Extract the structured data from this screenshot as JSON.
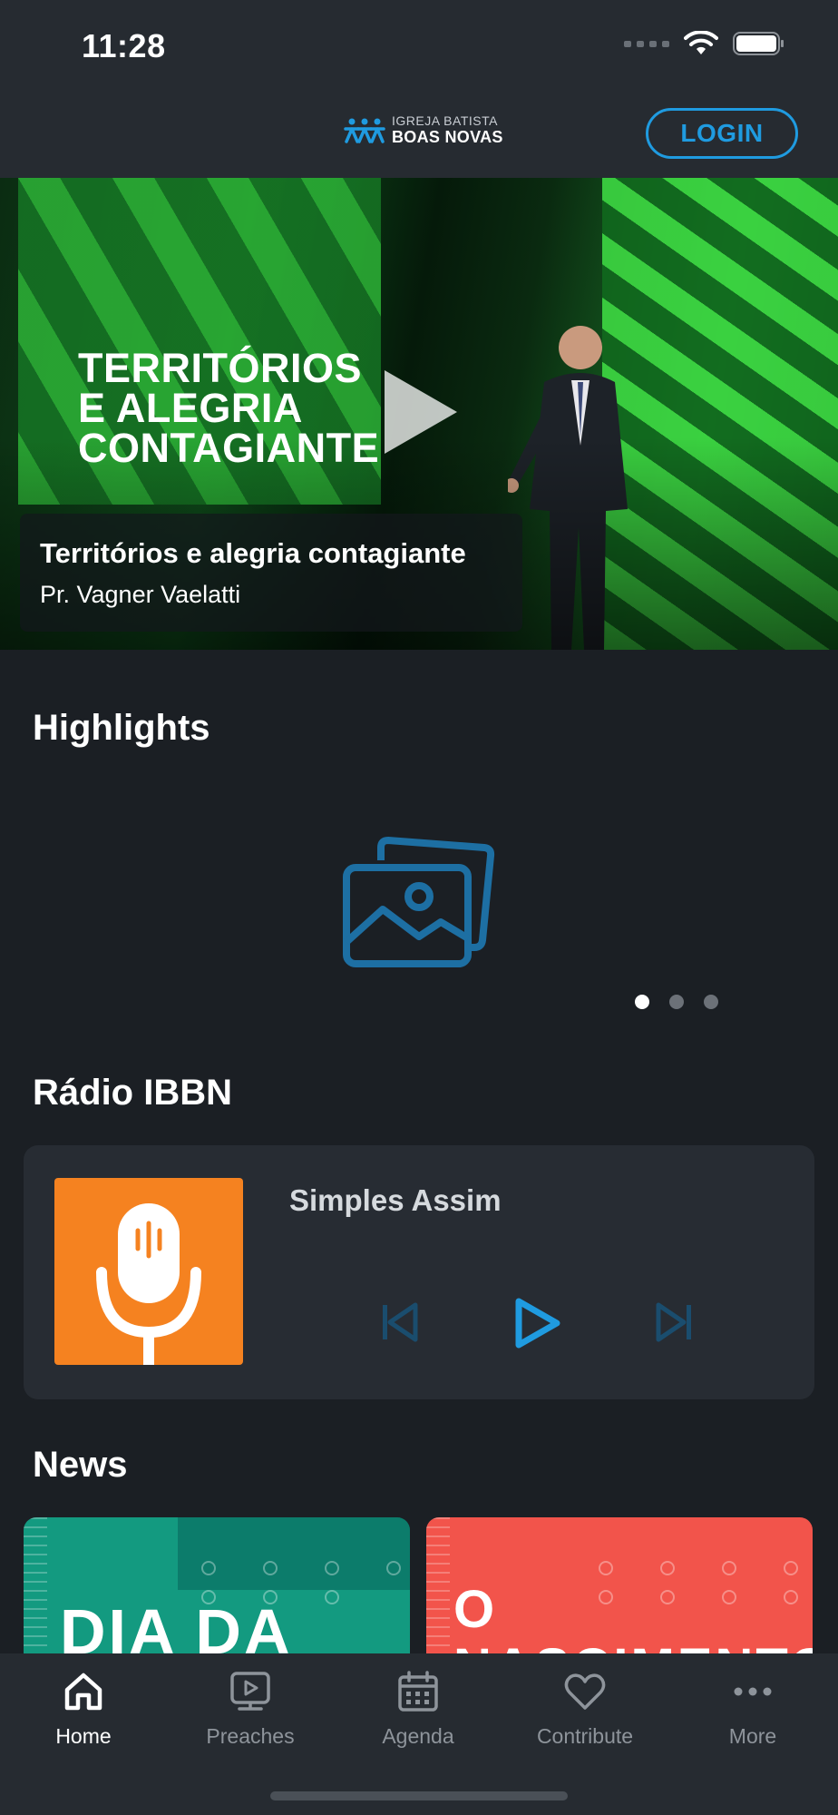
{
  "status_bar": {
    "time": "11:28"
  },
  "header": {
    "logo_line1": "IGREJA BATISTA",
    "logo_line2": "BOAS NOVAS",
    "login_label": "LOGIN",
    "accent_color": "#1f9be0"
  },
  "hero": {
    "art_title_lines": [
      "TERRITÓRIOS",
      "E ALEGRIA",
      "CONTAGIANTE"
    ],
    "caption_title": "Territórios e alegria contagiante",
    "caption_subtitle": "Pr. Vagner Vaelatti"
  },
  "highlights": {
    "title": "Highlights",
    "placeholder_icon": "image-placeholder-icon",
    "pages": 3,
    "active_page": 1
  },
  "radio": {
    "title": "Rádio IBBN",
    "track_title": "Simples Assim",
    "art_icon": "microphone-icon",
    "art_color": "#f58220"
  },
  "news": {
    "title": "News",
    "items": [
      {
        "text": "DIA DA",
        "color": "#139a80"
      },
      {
        "text": "O NASCIMENTO",
        "color": "#f2544b"
      }
    ]
  },
  "tabs": [
    {
      "label": "Home",
      "icon": "home-icon",
      "active": true
    },
    {
      "label": "Preaches",
      "icon": "video-icon",
      "active": false
    },
    {
      "label": "Agenda",
      "icon": "calendar-icon",
      "active": false
    },
    {
      "label": "Contribute",
      "icon": "heart-icon",
      "active": false
    },
    {
      "label": "More",
      "icon": "more-icon",
      "active": false
    }
  ]
}
